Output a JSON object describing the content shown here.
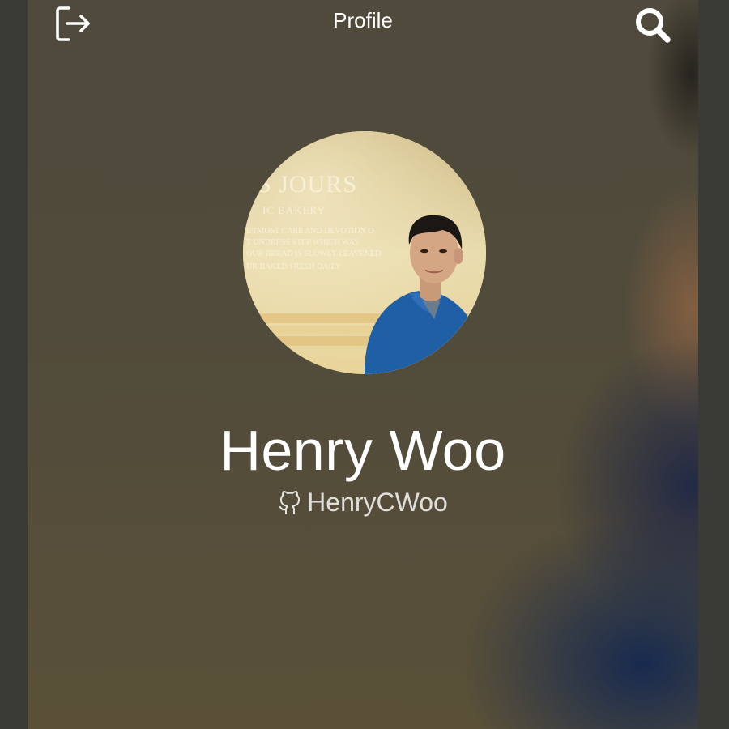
{
  "nav": {
    "title": "Profile",
    "left_icon": "logout-icon",
    "right_icon": "search-icon"
  },
  "profile": {
    "name": "Henry Woo",
    "github_icon": "github-icon",
    "handle": "HenryCWoo",
    "photo_sign_lines": [
      "S JOURS",
      "IC BAKERY",
      "UTMOST CARE AND DEVOTION O",
      "T UNDRESS STEP WHICH WAS",
      "OUR BREAD IS SLOWLY LEAVENED",
      "UR BAKED FRESH DAILY"
    ]
  },
  "colors": {
    "text": "#ffffff",
    "background": "#514b3b"
  }
}
